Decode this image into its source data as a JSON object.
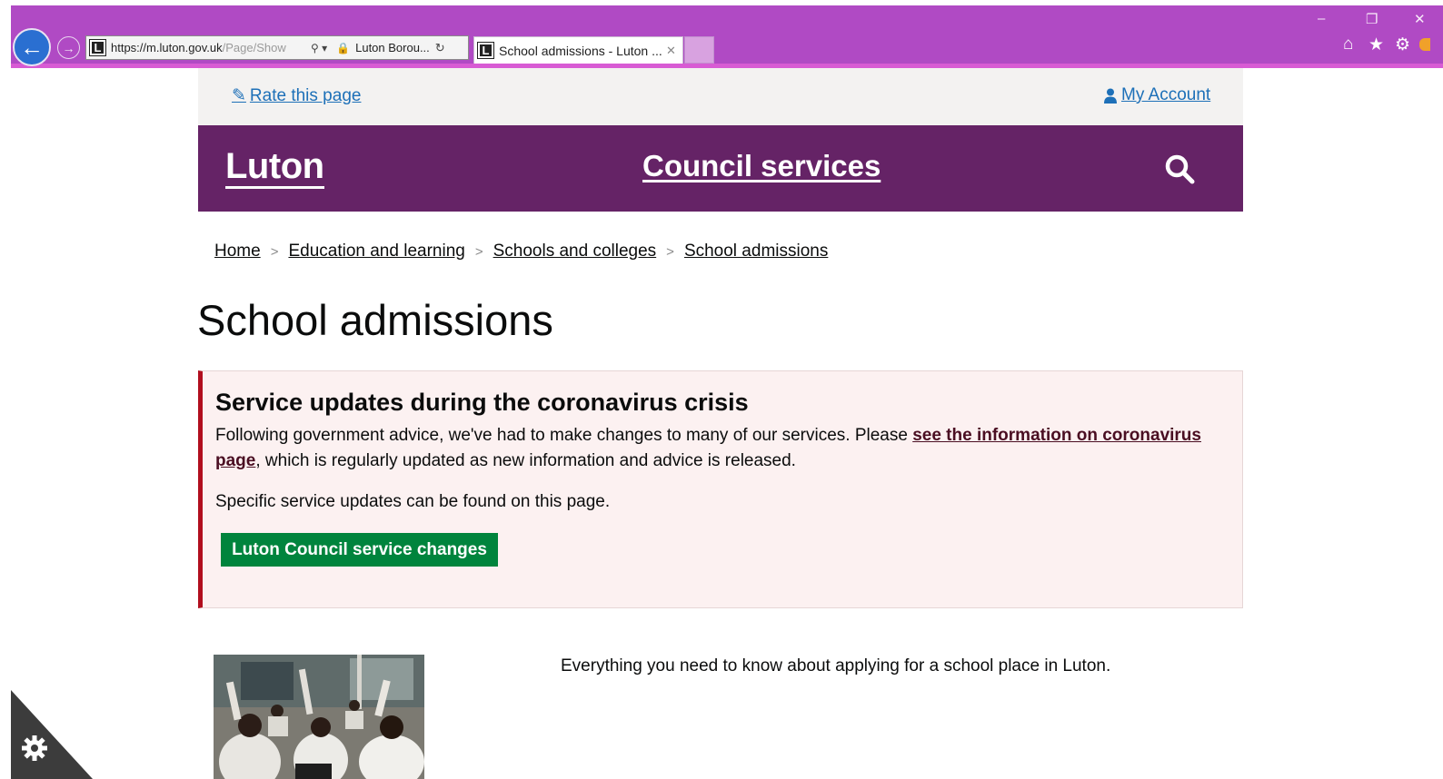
{
  "browser": {
    "url_scheme": "https://",
    "url_host": "m.luton.gov.uk",
    "url_path": "/Page/Show",
    "site_identity": "Luton Borou...",
    "tab_title": "School admissions - Luton ...",
    "favicon_letter": "L",
    "back_icon": "arrow-left-icon",
    "forward_icon": "arrow-right-icon",
    "toolbar_icons": [
      "home-icon",
      "star-icon",
      "gear-icon"
    ],
    "chrome_color": "#b04ac4"
  },
  "utility_bar": {
    "rate_label": "Rate this page",
    "account_label": "My Account"
  },
  "header": {
    "logo": "Luton",
    "section_title": "Council services",
    "color": "#652366"
  },
  "breadcrumb": {
    "items": [
      "Home",
      "Education and learning",
      "Schools and colleges",
      "School admissions"
    ],
    "separator": ">"
  },
  "page": {
    "title": "School admissions",
    "intro": "Everything you need to know about applying for a school place in Luton."
  },
  "notice": {
    "heading": "Service updates during the coronavirus crisis",
    "text_before": "Following government advice, we've had to make changes to many of our services. Please ",
    "link_text": "see the information on coronavirus page",
    "text_after": ", which is regularly updated as new information and advice is released.",
    "text2": "Specific service updates can be found on this page.",
    "button_label": "Luton Council service changes",
    "button_color": "#00843d",
    "border_color": "#b10e1e"
  }
}
